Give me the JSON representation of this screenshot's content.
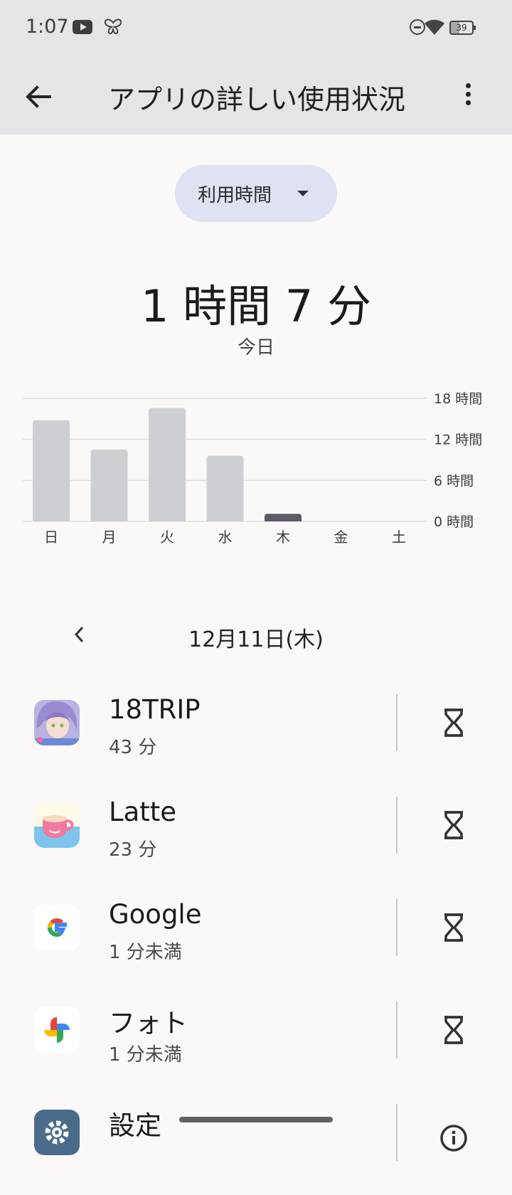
{
  "status_bar": {
    "time": "1:07",
    "battery": "39"
  },
  "app_bar": {
    "title": "アプリの詳しい使用状況"
  },
  "dropdown": {
    "label": "利用時間"
  },
  "summary": {
    "total": "1 時間 7 分",
    "caption": "今日"
  },
  "chart_data": {
    "type": "bar",
    "categories": [
      "日",
      "月",
      "火",
      "水",
      "木",
      "金",
      "土"
    ],
    "values": [
      14.8,
      10.5,
      16.6,
      9.6,
      1.1,
      0,
      0
    ],
    "highlight_index": 4,
    "y_ticks": [
      {
        "value": 18,
        "label": "18 時間"
      },
      {
        "value": 12,
        "label": "12 時間"
      },
      {
        "value": 6,
        "label": "6 時間"
      },
      {
        "value": 0,
        "label": "0 時間"
      }
    ],
    "ylim": [
      0,
      18
    ],
    "bar_color": "#cdcfd2",
    "highlight_color": "#5a5c66",
    "grid": true
  },
  "date_nav": {
    "label": "12月11日(木)"
  },
  "apps": [
    {
      "name": "18TRIP",
      "usage": "43 分"
    },
    {
      "name": "Latte",
      "usage": "23 分"
    },
    {
      "name": "Google",
      "usage": "1 分未満"
    },
    {
      "name": "フォト",
      "usage": "1 分未満"
    },
    {
      "name": "設定",
      "usage": ""
    }
  ]
}
